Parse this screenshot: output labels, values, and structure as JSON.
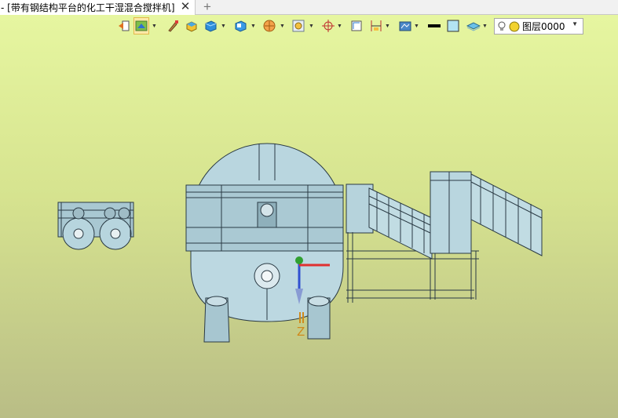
{
  "tab": {
    "title": "- [带有钢结构平台的化工干湿混合搅拌机]",
    "close_glyph": "✕",
    "new_tab_glyph": "+"
  },
  "toolbar": {
    "items": [
      {
        "name": "exit-icon"
      },
      {
        "name": "filter-select-icon",
        "active": true,
        "dropdown": true
      },
      {
        "name": "brush-icon"
      },
      {
        "name": "face-color-icon"
      },
      {
        "name": "render-style-icon",
        "dropdown": true
      },
      {
        "name": "view-orient-icon",
        "dropdown": true
      },
      {
        "name": "section-view-icon",
        "dropdown": true
      },
      {
        "name": "display-filter-icon",
        "dropdown": true
      },
      {
        "name": "snap-point-icon",
        "dropdown": true
      },
      {
        "name": "workplane-icon"
      },
      {
        "name": "dimension-icon",
        "dropdown": true
      },
      {
        "name": "render-mode-icon",
        "dropdown": true
      },
      {
        "name": "line-style-icon"
      },
      {
        "name": "color-swatch-icon"
      },
      {
        "name": "layers-icon",
        "dropdown": true
      }
    ]
  },
  "layer_selector": {
    "value": "图层0000",
    "dropdown_glyph": "▼"
  },
  "triad": {
    "z_label": "Z"
  },
  "colors": {
    "background_top": "#e6f6a0",
    "background_bottom": "#b9bd86",
    "model_fill": "#b3d3dc",
    "model_edge": "#2a3a44",
    "axis_x": "#e03030",
    "axis_y": "#30a030",
    "axis_z": "#3050d0"
  }
}
